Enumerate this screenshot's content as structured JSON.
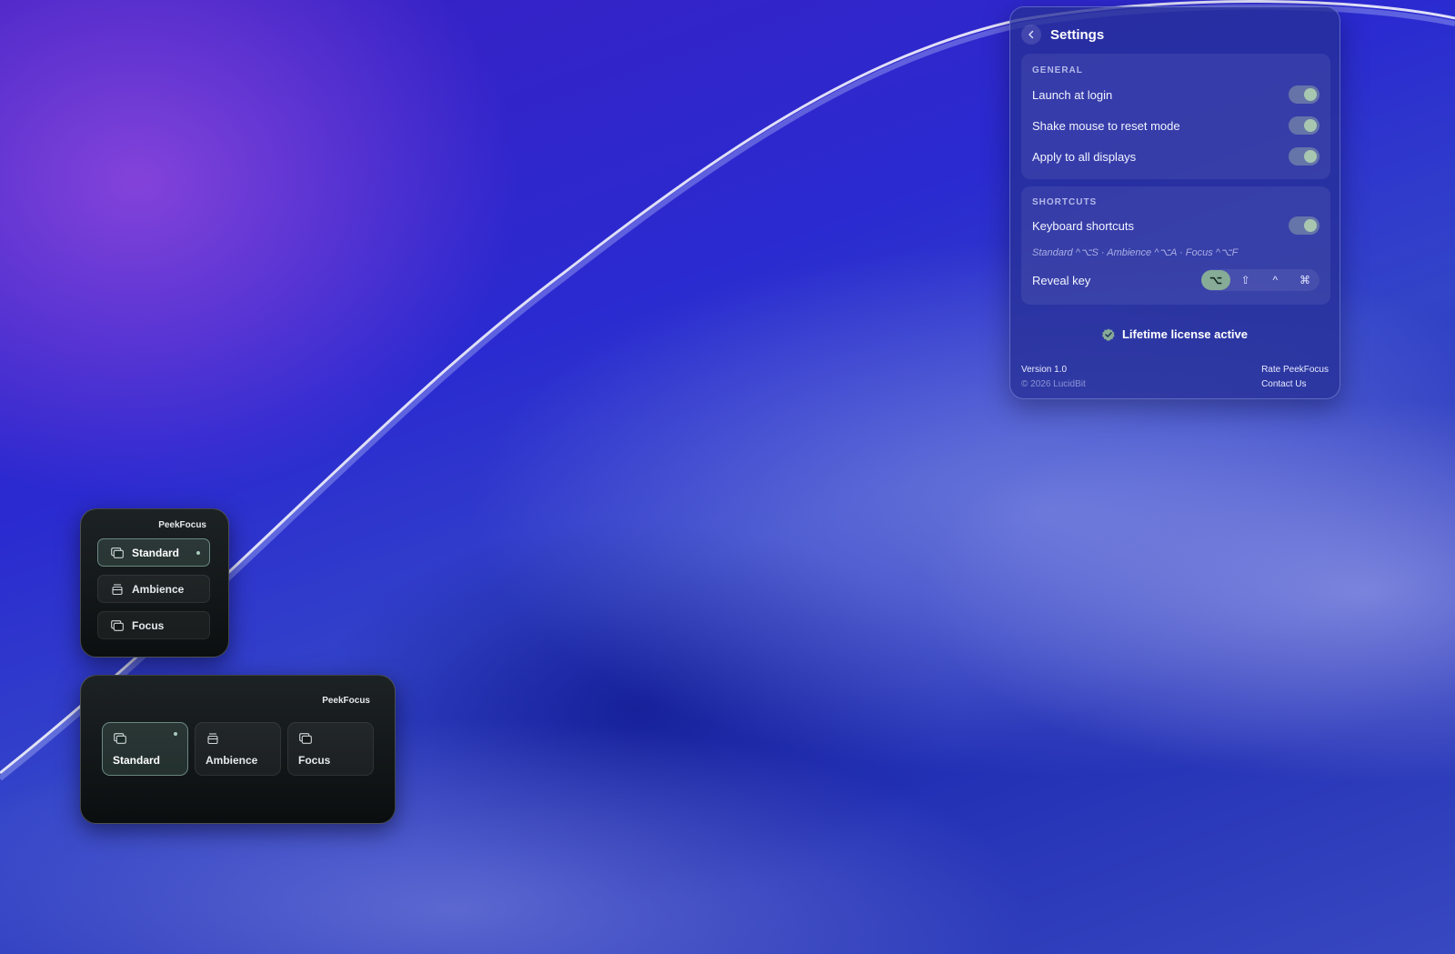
{
  "settings": {
    "title": "Settings",
    "general": {
      "heading": "GENERAL",
      "items": [
        {
          "label": "Launch at login",
          "enabled": true
        },
        {
          "label": "Shake mouse to reset mode",
          "enabled": true
        },
        {
          "label": "Apply to all displays",
          "enabled": true
        }
      ]
    },
    "shortcuts": {
      "heading": "SHORTCUTS",
      "keyboard_label": "Keyboard shortcuts",
      "keyboard_enabled": true,
      "hint": "Standard ^⌥S  ·  Ambience ^⌥A  ·  Focus ^⌥F",
      "reveal_label": "Reveal key",
      "reveal_options": [
        "⌥",
        "⇧",
        "^",
        "⌘"
      ],
      "reveal_selected": "⌥"
    },
    "license": "Lifetime license active",
    "version": "Version 1.0",
    "copyright": "© 2026 LucidBit",
    "rate_link": "Rate PeekFocus",
    "contact_link": "Contact Us"
  },
  "widget_vertical": {
    "brand": "PeekFocus",
    "modes": [
      "Standard",
      "Ambience",
      "Focus"
    ],
    "selected": "Standard"
  },
  "widget_horizontal": {
    "brand": "PeekFocus",
    "modes": [
      "Standard",
      "Ambience",
      "Focus"
    ],
    "selected": "Standard"
  },
  "colors": {
    "accent": "#86ab97",
    "panel": "#26309a"
  }
}
